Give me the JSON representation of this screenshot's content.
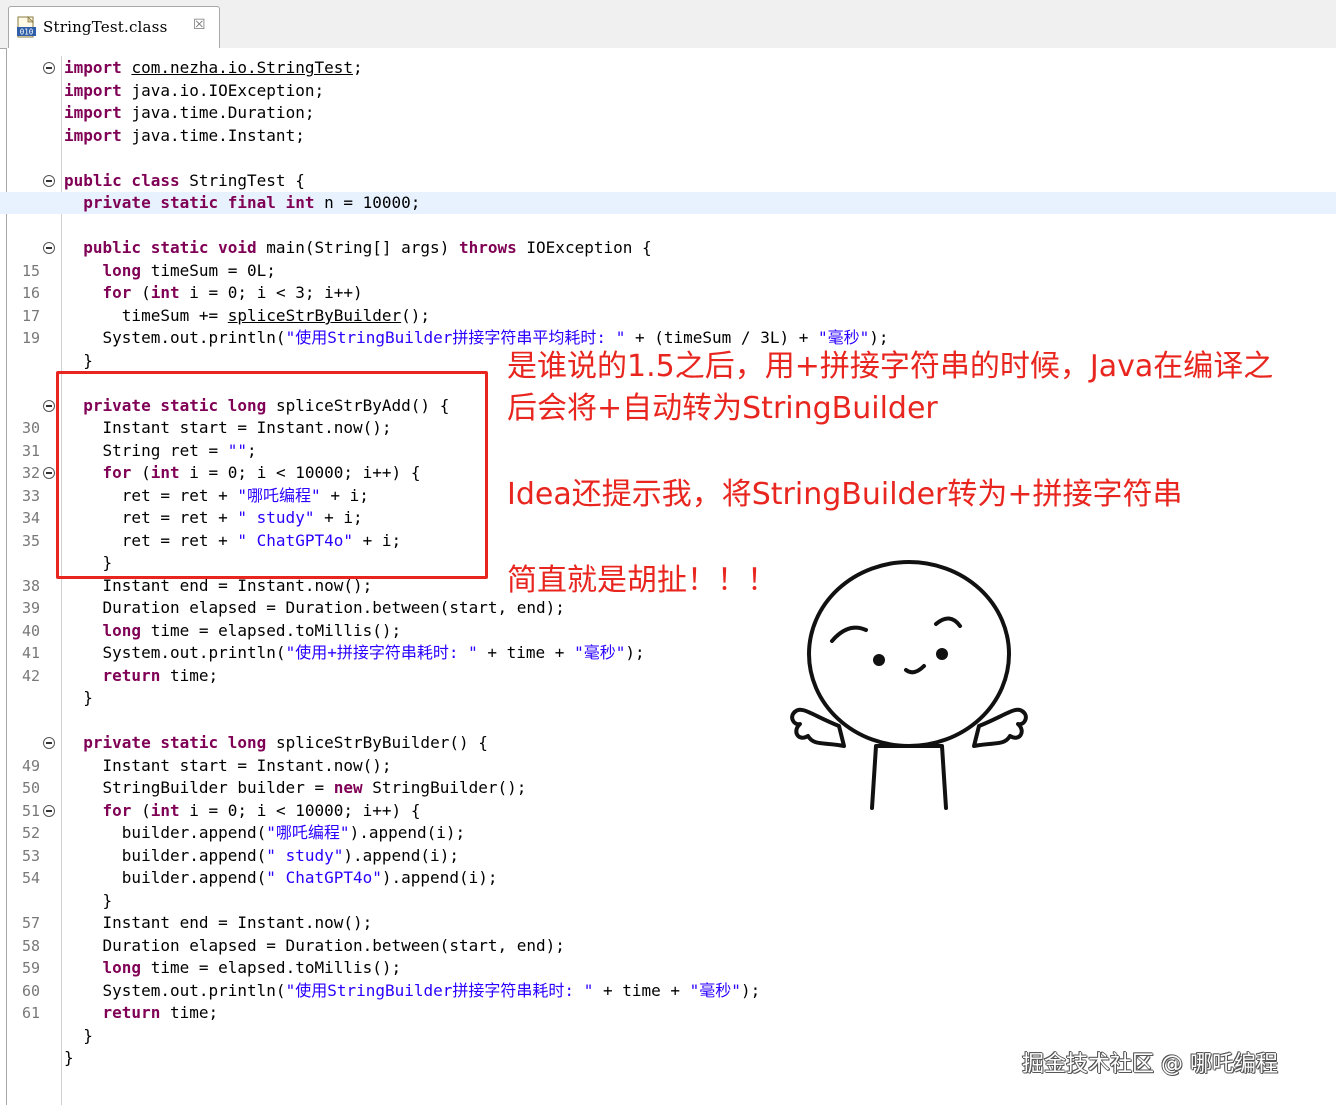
{
  "tab": {
    "title": "StringTest.class",
    "close": "☒"
  },
  "code": {
    "lines": [
      {
        "y": 0,
        "num": "",
        "fold": true,
        "tokens": [
          [
            "kw",
            "import"
          ],
          [
            "",
            ""
          ],
          [
            "u",
            "com.nezha.io.StringTest"
          ],
          [
            "",
            ";"
          ]
        ]
      },
      {
        "y": 1,
        "num": "",
        "tokens": [
          [
            "kw",
            "import"
          ],
          [
            "",
            ""
          ],
          [
            "",
            "java.io.IOException;"
          ]
        ]
      },
      {
        "y": 2,
        "num": "",
        "tokens": [
          [
            "kw",
            "import"
          ],
          [
            "",
            ""
          ],
          [
            "",
            "java.time.Duration;"
          ]
        ]
      },
      {
        "y": 3,
        "num": "",
        "tokens": [
          [
            "kw",
            "import"
          ],
          [
            "",
            ""
          ],
          [
            "",
            "java.time.Instant;"
          ]
        ]
      },
      {
        "y": 5,
        "num": "",
        "fold": true,
        "tokens": [
          [
            "kw",
            "public class"
          ],
          [
            "",
            ""
          ],
          [
            "",
            "StringTest {"
          ]
        ]
      },
      {
        "y": 6,
        "num": "",
        "hl": true,
        "tokens": [
          [
            "",
            "  "
          ],
          [
            "kw",
            "private static final int"
          ],
          [
            "",
            ""
          ],
          [
            "",
            "n = 10000;"
          ]
        ]
      },
      {
        "y": 8,
        "num": "",
        "fold": true,
        "tokens": [
          [
            "",
            "  "
          ],
          [
            "kw",
            "public static void"
          ],
          [
            "",
            ""
          ],
          [
            "",
            "main(String[] args)"
          ],
          [
            "",
            ""
          ],
          [
            "kw",
            "throws"
          ],
          [
            "",
            ""
          ],
          [
            "",
            "IOException {"
          ]
        ]
      },
      {
        "y": 9,
        "num": "15",
        "tokens": [
          [
            "",
            "    "
          ],
          [
            "kw",
            "long"
          ],
          [
            "",
            ""
          ],
          [
            "",
            "timeSum = 0L;"
          ]
        ]
      },
      {
        "y": 10,
        "num": "16",
        "tokens": [
          [
            "",
            "    "
          ],
          [
            "kw",
            "for"
          ],
          [
            "",
            ""
          ],
          [
            "",
            "("
          ],
          [
            "kw",
            "int"
          ],
          [
            "",
            ""
          ],
          [
            "",
            "i = 0; i < 3; i++)"
          ]
        ]
      },
      {
        "y": 11,
        "num": "17",
        "tokens": [
          [
            "",
            "      timeSum += "
          ],
          [
            "u",
            "spliceStrByBuilder"
          ],
          [
            "",
            "();"
          ]
        ]
      },
      {
        "y": 12,
        "num": "19",
        "tokens": [
          [
            "",
            "    System.out.println("
          ],
          [
            "str",
            "\"使用StringBuilder拼接字符串平均耗时: \""
          ],
          [
            "",
            ""
          ],
          [
            "",
            "+ (timeSum / 3L) +"
          ],
          [
            "",
            ""
          ],
          [
            "str",
            "\"毫秒\""
          ],
          [
            "",
            ");"
          ]
        ]
      },
      {
        "y": 13,
        "num": "",
        "tokens": [
          [
            "",
            "  }"
          ]
        ]
      },
      {
        "y": 15,
        "num": "",
        "fold": true,
        "tokens": [
          [
            "",
            "  "
          ],
          [
            "kw",
            "private static long"
          ],
          [
            "",
            ""
          ],
          [
            "",
            "spliceStrByAdd() {"
          ]
        ]
      },
      {
        "y": 16,
        "num": "30",
        "tokens": [
          [
            "",
            "    Instant start = Instant.now();"
          ]
        ]
      },
      {
        "y": 17,
        "num": "31",
        "tokens": [
          [
            "",
            "    String ret = "
          ],
          [
            "str",
            "\"\""
          ],
          [
            "",
            ";"
          ]
        ]
      },
      {
        "y": 18,
        "num": "32",
        "fold": true,
        "tokens": [
          [
            "",
            "    "
          ],
          [
            "kw",
            "for"
          ],
          [
            "",
            ""
          ],
          [
            "",
            "("
          ],
          [
            "kw",
            "int"
          ],
          [
            "",
            ""
          ],
          [
            "",
            "i = 0; i < 10000; i++) {"
          ]
        ]
      },
      {
        "y": 19,
        "num": "33",
        "tokens": [
          [
            "",
            "      ret = ret + "
          ],
          [
            "str",
            "\"哪吒编程\""
          ],
          [
            "",
            ""
          ],
          [
            "",
            "+ i;"
          ]
        ]
      },
      {
        "y": 20,
        "num": "34",
        "tokens": [
          [
            "",
            "      ret = ret + "
          ],
          [
            "str",
            "\" study\""
          ],
          [
            "",
            ""
          ],
          [
            "",
            "+ i;"
          ]
        ]
      },
      {
        "y": 21,
        "num": "35",
        "tokens": [
          [
            "",
            "      ret = ret + "
          ],
          [
            "str",
            "\" ChatGPT4o\""
          ],
          [
            "",
            ""
          ],
          [
            "",
            "+ i;"
          ]
        ]
      },
      {
        "y": 22,
        "num": "",
        "tokens": [
          [
            "",
            "    }"
          ]
        ]
      },
      {
        "y": 23,
        "num": "38",
        "tokens": [
          [
            "",
            "    Instant end = Instant.now();"
          ]
        ]
      },
      {
        "y": 24,
        "num": "39",
        "tokens": [
          [
            "",
            "    Duration elapsed = Duration.between(start, end);"
          ]
        ]
      },
      {
        "y": 25,
        "num": "40",
        "tokens": [
          [
            "",
            "    "
          ],
          [
            "kw",
            "long"
          ],
          [
            "",
            ""
          ],
          [
            "",
            "time = elapsed.toMillis();"
          ]
        ]
      },
      {
        "y": 26,
        "num": "41",
        "tokens": [
          [
            "",
            "    System.out.println("
          ],
          [
            "str",
            "\"使用+拼接字符串耗时: \""
          ],
          [
            "",
            ""
          ],
          [
            "",
            "+ time +"
          ],
          [
            "",
            ""
          ],
          [
            "str",
            "\"毫秒\""
          ],
          [
            "",
            ");"
          ]
        ]
      },
      {
        "y": 27,
        "num": "42",
        "tokens": [
          [
            "",
            "    "
          ],
          [
            "kw",
            "return"
          ],
          [
            "",
            ""
          ],
          [
            "",
            "time;"
          ]
        ]
      },
      {
        "y": 28,
        "num": "",
        "tokens": [
          [
            "",
            "  }"
          ]
        ]
      },
      {
        "y": 30,
        "num": "",
        "fold": true,
        "tokens": [
          [
            "",
            "  "
          ],
          [
            "kw",
            "private static long"
          ],
          [
            "",
            ""
          ],
          [
            "",
            "spliceStrByBuilder() {"
          ]
        ]
      },
      {
        "y": 31,
        "num": "49",
        "tokens": [
          [
            "",
            "    Instant start = Instant.now();"
          ]
        ]
      },
      {
        "y": 32,
        "num": "50",
        "tokens": [
          [
            "",
            "    StringBuilder builder = "
          ],
          [
            "kw",
            "new"
          ],
          [
            "",
            ""
          ],
          [
            "",
            "StringBuilder();"
          ]
        ]
      },
      {
        "y": 33,
        "num": "51",
        "fold": true,
        "tokens": [
          [
            "",
            "    "
          ],
          [
            "kw",
            "for"
          ],
          [
            "",
            ""
          ],
          [
            "",
            "("
          ],
          [
            "kw",
            "int"
          ],
          [
            "",
            ""
          ],
          [
            "",
            "i = 0; i < 10000; i++) {"
          ]
        ]
      },
      {
        "y": 34,
        "num": "52",
        "tokens": [
          [
            "",
            "      builder.append("
          ],
          [
            "str",
            "\"哪吒编程\""
          ],
          [
            "",
            ").append(i);"
          ]
        ]
      },
      {
        "y": 35,
        "num": "53",
        "tokens": [
          [
            "",
            "      builder.append("
          ],
          [
            "str",
            "\" study\""
          ],
          [
            "",
            ").append(i);"
          ]
        ]
      },
      {
        "y": 36,
        "num": "54",
        "tokens": [
          [
            "",
            "      builder.append("
          ],
          [
            "str",
            "\" ChatGPT4o\""
          ],
          [
            "",
            ").append(i);"
          ]
        ]
      },
      {
        "y": 37,
        "num": "",
        "tokens": [
          [
            "",
            "    }"
          ]
        ]
      },
      {
        "y": 38,
        "num": "57",
        "tokens": [
          [
            "",
            "    Instant end = Instant.now();"
          ]
        ]
      },
      {
        "y": 39,
        "num": "58",
        "tokens": [
          [
            "",
            "    Duration elapsed = Duration.between(start, end);"
          ]
        ]
      },
      {
        "y": 40,
        "num": "59",
        "tokens": [
          [
            "",
            "    "
          ],
          [
            "kw",
            "long"
          ],
          [
            "",
            ""
          ],
          [
            "",
            "time = elapsed.toMillis();"
          ]
        ]
      },
      {
        "y": 41,
        "num": "60",
        "tokens": [
          [
            "",
            "    System.out.println("
          ],
          [
            "str",
            "\"使用StringBuilder拼接字符串耗时: \""
          ],
          [
            "",
            ""
          ],
          [
            "",
            "+ time +"
          ],
          [
            "",
            ""
          ],
          [
            "str",
            "\"毫秒\""
          ],
          [
            "",
            ");"
          ]
        ]
      },
      {
        "y": 42,
        "num": "61",
        "tokens": [
          [
            "",
            "    "
          ],
          [
            "kw",
            "return"
          ],
          [
            "",
            ""
          ],
          [
            "",
            "time;"
          ]
        ]
      },
      {
        "y": 43,
        "num": "",
        "tokens": [
          [
            "",
            "  }"
          ]
        ]
      },
      {
        "y": 44,
        "num": "",
        "tokens": [
          [
            "",
            "}"
          ]
        ]
      }
    ]
  },
  "annotations": {
    "line1": "是谁说的1.5之后，用+拼接字符串的时候，Java在编译之",
    "line2": "后会将+自动转为StringBuilder",
    "line3": "Idea还提示我，将StringBuilder转为+拼接字符串",
    "line4": "简直就是胡扯！！！"
  },
  "watermark": "掘金技术社区 @ 哪吒编程"
}
